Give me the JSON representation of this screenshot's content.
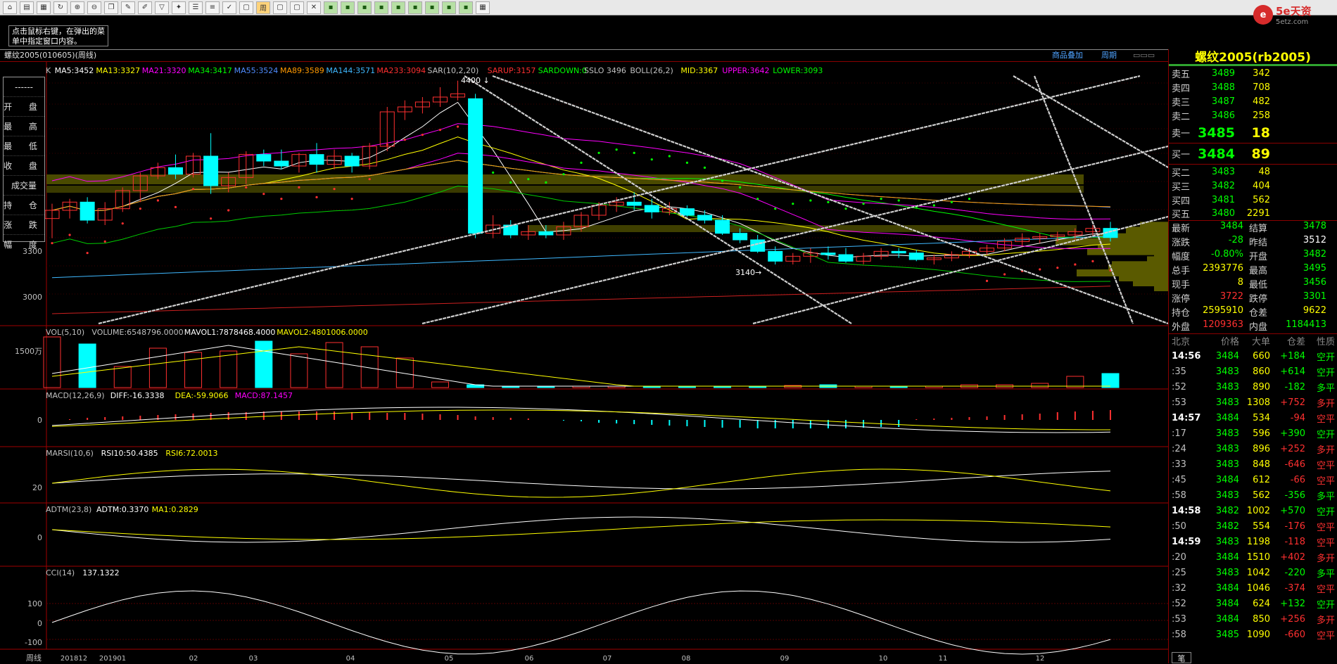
{
  "toolbar": {
    "tabs": [
      "周"
    ]
  },
  "logo": {
    "brand": "5e天资",
    "url": "5etz.com"
  },
  "hint": "点击鼠标右键，在弹出的菜单中指定窗口内容。",
  "title": "螺纹2005(010605)(周线)",
  "links": {
    "overlay": "商品叠加",
    "period": "周期"
  },
  "main": {
    "legend": [
      {
        "t": "K",
        "c": "#c0c0c0"
      },
      {
        "t": "MA5:3452",
        "c": "#ffffff"
      },
      {
        "t": "MA13:3327",
        "c": "#ffff00"
      },
      {
        "t": "MA21:3320",
        "c": "#ff00ff"
      },
      {
        "t": "MA34:3417",
        "c": "#00ff00"
      },
      {
        "t": "MA55:3524",
        "c": "#4f8cff"
      },
      {
        "t": "MA89:3589",
        "c": "#ff9900"
      },
      {
        "t": "MA144:3571",
        "c": "#3fb8ff"
      },
      {
        "t": "MA233:3094",
        "c": "#ff3030"
      },
      {
        "t": "SAR(10,2,20)",
        "c": "#c0c0c0"
      },
      {
        "t": "SARUP:3157",
        "c": "#ff3030"
      },
      {
        "t": "SARDOWN:0",
        "c": "#00ff00"
      },
      {
        "t": "SSLO 3496",
        "c": "#c0c0c0"
      },
      {
        "t": "BOLL(26,2)",
        "c": "#c0c0c0"
      },
      {
        "t": "MID:3367",
        "c": "#ffff00"
      },
      {
        "t": "UPPER:3642",
        "c": "#ff00ff"
      },
      {
        "t": "LOWER:3093",
        "c": "#00ff00"
      }
    ],
    "yaxis": [
      "3300",
      "3000"
    ],
    "annot": {
      "high": "4400",
      "low": "3140"
    },
    "ohlc": [
      "开 盘",
      "最 高",
      "最 低",
      "收 盘",
      "成交量",
      "持 仓",
      "涨 跌",
      "幅 度"
    ],
    "ohlc_top": "------"
  },
  "vol": {
    "legend": [
      {
        "t": "VOL(5,10)",
        "c": "#c0c0c0"
      },
      {
        "t": "VOLUME:6548796.0000",
        "c": "#c0c0c0"
      },
      {
        "t": "MAVOL1:7878468.4000",
        "c": "#ffffff"
      },
      {
        "t": "MAVOL2:4801006.0000",
        "c": "#ffff00"
      }
    ],
    "y": "1500万"
  },
  "macd": {
    "legend": [
      {
        "t": "MACD(12,26,9)",
        "c": "#c0c0c0"
      },
      {
        "t": "DIFF:-16.3338",
        "c": "#ffffff"
      },
      {
        "t": "DEA:-59.9066",
        "c": "#ffff00"
      },
      {
        "t": "MACD:87.1457",
        "c": "#ff00ff"
      }
    ],
    "y": "0"
  },
  "marsi": {
    "legend": [
      {
        "t": "MARSI(10,6)",
        "c": "#c0c0c0"
      },
      {
        "t": "RSI10:50.4385",
        "c": "#ffffff"
      },
      {
        "t": "RSI6:72.0013",
        "c": "#ffff00"
      }
    ],
    "y": "20"
  },
  "adtm": {
    "legend": [
      {
        "t": "ADTM(23,8)",
        "c": "#c0c0c0"
      },
      {
        "t": "ADTM:0.3370",
        "c": "#ffffff"
      },
      {
        "t": "MA1:0.2829",
        "c": "#ffff00"
      }
    ],
    "y": "0"
  },
  "cci": {
    "legend": [
      {
        "t": "CCI(14)",
        "c": "#c0c0c0"
      },
      {
        "t": "137.1322",
        "c": "#ffffff"
      }
    ],
    "y": [
      "100",
      "0",
      "-100"
    ]
  },
  "xaxis": {
    "period": "周线",
    "labels": [
      "201812",
      "201901",
      "02",
      "03",
      "04",
      "05",
      "06",
      "07",
      "08",
      "09",
      "10",
      "11",
      "12"
    ]
  },
  "quote": {
    "name": "螺纹2005(rb2005)",
    "asks": [
      {
        "l": "卖五",
        "p": "3489",
        "v": "342"
      },
      {
        "l": "卖四",
        "p": "3488",
        "v": "708"
      },
      {
        "l": "卖三",
        "p": "3487",
        "v": "482"
      },
      {
        "l": "卖二",
        "p": "3486",
        "v": "258"
      }
    ],
    "ask1": {
      "l": "卖一",
      "p": "3485",
      "v": "18"
    },
    "bid1": {
      "l": "买一",
      "p": "3484",
      "v": "89"
    },
    "bids": [
      {
        "l": "买二",
        "p": "3483",
        "v": "48"
      },
      {
        "l": "买三",
        "p": "3482",
        "v": "404"
      },
      {
        "l": "买四",
        "p": "3481",
        "v": "562"
      },
      {
        "l": "买五",
        "p": "3480",
        "v": "2291"
      }
    ],
    "stats": [
      {
        "a": "最新",
        "b": "3484",
        "bc": "#00ff00",
        "c": "结算",
        "d": "3478",
        "dc": "#00ff00"
      },
      {
        "a": "涨跌",
        "b": "-28",
        "bc": "#00ff00",
        "c": "昨结",
        "d": "3512",
        "dc": "#ffffff"
      },
      {
        "a": "幅度",
        "b": "-0.80%",
        "bc": "#00ff00",
        "c": "开盘",
        "d": "3482",
        "dc": "#00ff00"
      },
      {
        "a": "总手",
        "b": "2393776",
        "bc": "#ffff00",
        "c": "最高",
        "d": "3495",
        "dc": "#00ff00"
      },
      {
        "a": "现手",
        "b": "8",
        "bc": "#ffff00",
        "c": "最低",
        "d": "3456",
        "dc": "#00ff00"
      },
      {
        "a": "涨停",
        "b": "3722",
        "bc": "#ff3030",
        "c": "跌停",
        "d": "3301",
        "dc": "#00ff00"
      },
      {
        "a": "持仓",
        "b": "2595910",
        "bc": "#ffff00",
        "c": "仓差",
        "d": "9622",
        "dc": "#ffff00"
      },
      {
        "a": "外盘",
        "b": "1209363",
        "bc": "#ff3030",
        "c": "内盘",
        "d": "1184413",
        "dc": "#00ff00"
      }
    ],
    "tick_header": [
      "北京",
      "价格",
      "大单",
      "仓差",
      "性质"
    ],
    "ticks": [
      {
        "t": "14:56",
        "p": "3484",
        "v": "660",
        "oi": "+184",
        "ty": "空开",
        "c": "#00ff00"
      },
      {
        "t": ":35",
        "p": "3483",
        "v": "860",
        "oi": "+614",
        "ty": "空开",
        "c": "#00ff00"
      },
      {
        "t": ":52",
        "p": "3483",
        "v": "890",
        "oi": "-182",
        "ty": "多平",
        "c": "#00ff00"
      },
      {
        "t": ":53",
        "p": "3483",
        "v": "1308",
        "oi": "+752",
        "ty": "多开",
        "c": "#ff3030"
      },
      {
        "t": "14:57",
        "p": "3484",
        "v": "534",
        "oi": "-94",
        "ty": "空平",
        "c": "#ff3030"
      },
      {
        "t": ":17",
        "p": "3483",
        "v": "596",
        "oi": "+390",
        "ty": "空开",
        "c": "#00ff00"
      },
      {
        "t": ":24",
        "p": "3483",
        "v": "896",
        "oi": "+252",
        "ty": "多开",
        "c": "#ff3030"
      },
      {
        "t": ":33",
        "p": "3483",
        "v": "848",
        "oi": "-646",
        "ty": "空平",
        "c": "#ff3030"
      },
      {
        "t": ":45",
        "p": "3484",
        "v": "612",
        "oi": "-66",
        "ty": "空平",
        "c": "#ff3030"
      },
      {
        "t": ":58",
        "p": "3483",
        "v": "562",
        "oi": "-356",
        "ty": "多平",
        "c": "#00ff00"
      },
      {
        "t": "14:58",
        "p": "3482",
        "v": "1002",
        "oi": "+570",
        "ty": "空开",
        "c": "#00ff00"
      },
      {
        "t": ":50",
        "p": "3482",
        "v": "554",
        "oi": "-176",
        "ty": "空平",
        "c": "#ff3030"
      },
      {
        "t": "14:59",
        "p": "3483",
        "v": "1198",
        "oi": "-118",
        "ty": "空平",
        "c": "#ff3030"
      },
      {
        "t": ":20",
        "p": "3484",
        "v": "1510",
        "oi": "+402",
        "ty": "多开",
        "c": "#ff3030"
      },
      {
        "t": ":25",
        "p": "3483",
        "v": "1042",
        "oi": "-220",
        "ty": "多平",
        "c": "#00ff00"
      },
      {
        "t": ":32",
        "p": "3484",
        "v": "1046",
        "oi": "-374",
        "ty": "空平",
        "c": "#ff3030"
      },
      {
        "t": ":52",
        "p": "3484",
        "v": "624",
        "oi": "+132",
        "ty": "空开",
        "c": "#00ff00"
      },
      {
        "t": ":53",
        "p": "3484",
        "v": "850",
        "oi": "+256",
        "ty": "多开",
        "c": "#ff3030"
      },
      {
        "t": ":58",
        "p": "3485",
        "v": "1090",
        "oi": "-660",
        "ty": "空平",
        "c": "#ff3030"
      }
    ],
    "bottom_tab": "笔"
  },
  "chart_data": {
    "type": "candlestick",
    "candles": [
      [
        3600,
        3690,
        3480,
        3650
      ],
      [
        3650,
        3720,
        3600,
        3700
      ],
      [
        3700,
        3730,
        3570,
        3590
      ],
      [
        3590,
        3700,
        3560,
        3660
      ],
      [
        3660,
        3790,
        3640,
        3770
      ],
      [
        3770,
        3880,
        3700,
        3860
      ],
      [
        3860,
        3940,
        3840,
        3910
      ],
      [
        3910,
        3990,
        3840,
        3870
      ],
      [
        3870,
        4000,
        3850,
        3980
      ],
      [
        3980,
        4120,
        3750,
        3800
      ],
      [
        3800,
        3880,
        3760,
        3850
      ],
      [
        3850,
        4010,
        3810,
        3990
      ],
      [
        3990,
        4020,
        3920,
        3950
      ],
      [
        3950,
        4020,
        3900,
        3920
      ],
      [
        3920,
        4000,
        3880,
        3990
      ],
      [
        3990,
        4060,
        3880,
        3930
      ],
      [
        3930,
        4020,
        3900,
        3980
      ],
      [
        3980,
        4000,
        3880,
        3920
      ],
      [
        3920,
        4060,
        3900,
        4040
      ],
      [
        4040,
        4280,
        4010,
        4250
      ],
      [
        4250,
        4320,
        4200,
        4280
      ],
      [
        4280,
        4340,
        4240,
        4310
      ],
      [
        4310,
        4400,
        4280,
        4340
      ],
      [
        4340,
        4440,
        4320,
        4360
      ],
      [
        4330,
        4360,
        3480,
        3510
      ],
      [
        3510,
        3620,
        3480,
        3560
      ],
      [
        3560,
        3590,
        3480,
        3500
      ],
      [
        3500,
        3560,
        3470,
        3520
      ],
      [
        3520,
        3560,
        3480,
        3500
      ],
      [
        3500,
        3580,
        3470,
        3550
      ],
      [
        3550,
        3640,
        3520,
        3620
      ],
      [
        3620,
        3700,
        3590,
        3680
      ],
      [
        3680,
        3730,
        3640,
        3700
      ],
      [
        3700,
        3760,
        3650,
        3680
      ],
      [
        3680,
        3720,
        3600,
        3640
      ],
      [
        3640,
        3700,
        3620,
        3660
      ],
      [
        3660,
        3680,
        3610,
        3620
      ],
      [
        3620,
        3650,
        3570,
        3590
      ],
      [
        3590,
        3620,
        3500,
        3510
      ],
      [
        3510,
        3540,
        3450,
        3470
      ],
      [
        3470,
        3500,
        3390,
        3400
      ],
      [
        3400,
        3430,
        3320,
        3340
      ],
      [
        3340,
        3390,
        3320,
        3370
      ],
      [
        3370,
        3420,
        3330,
        3390
      ],
      [
        3390,
        3430,
        3350,
        3380
      ],
      [
        3380,
        3420,
        3330,
        3340
      ],
      [
        3340,
        3390,
        3320,
        3370
      ],
      [
        3370,
        3420,
        3350,
        3400
      ],
      [
        3400,
        3420,
        3360,
        3390
      ],
      [
        3390,
        3410,
        3340,
        3350
      ],
      [
        3350,
        3380,
        3320,
        3360
      ],
      [
        3360,
        3400,
        3340,
        3380
      ],
      [
        3380,
        3420,
        3360,
        3400
      ],
      [
        3400,
        3440,
        3380,
        3420
      ],
      [
        3420,
        3480,
        3400,
        3460
      ],
      [
        3460,
        3510,
        3430,
        3480
      ],
      [
        3480,
        3510,
        3450,
        3490
      ],
      [
        3490,
        3520,
        3460,
        3500
      ],
      [
        3500,
        3540,
        3470,
        3520
      ],
      [
        3520,
        3560,
        3490,
        3540
      ],
      [
        3540,
        3580,
        3460,
        3484
      ]
    ],
    "xlabels": [
      "201812",
      "201901",
      "02",
      "03",
      "04",
      "05",
      "06",
      "07",
      "08",
      "09",
      "10",
      "11",
      "12"
    ],
    "indicators": {
      "MA5": 3452,
      "MA13": 3327,
      "MA21": 3320,
      "MA34": 3417,
      "MA55": 3524,
      "MA89": 3589,
      "MA144": 3571,
      "MA233": 3094,
      "MID": 3367,
      "UPPER": 3642,
      "LOWER": 3093
    },
    "volume": {
      "VOLUME": 6548796.0,
      "MAVOL1": 7878468.4,
      "MAVOL2": 4801006.0
    },
    "macd": {
      "DIFF": -16.3338,
      "DEA": -59.9066,
      "MACD": 87.1457
    },
    "marsi": {
      "RSI10": 50.4385,
      "RSI6": 72.0013
    },
    "adtm": {
      "ADTM": 0.337,
      "MA1": 0.2829
    },
    "cci": 137.1322
  }
}
